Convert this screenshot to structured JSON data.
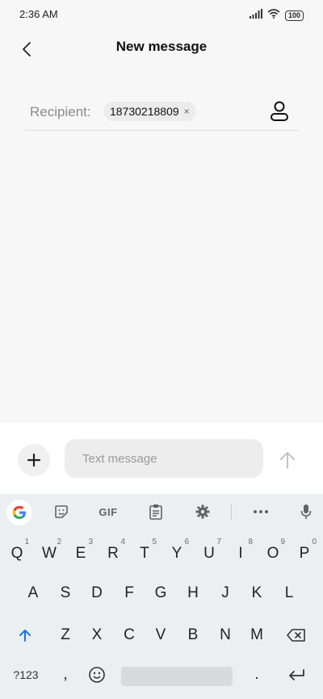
{
  "status": {
    "time": "2:36 AM",
    "battery": "100"
  },
  "header": {
    "title": "New message"
  },
  "recipient": {
    "label": "Recipient:",
    "chip": "18730218809",
    "remove": "×"
  },
  "compose": {
    "placeholder": "Text message"
  },
  "keyboard": {
    "toolbar": {
      "gif": "GIF"
    },
    "row1": [
      {
        "k": "Q",
        "h": "1"
      },
      {
        "k": "W",
        "h": "2"
      },
      {
        "k": "E",
        "h": "3"
      },
      {
        "k": "R",
        "h": "4"
      },
      {
        "k": "T",
        "h": "5"
      },
      {
        "k": "Y",
        "h": "6"
      },
      {
        "k": "U",
        "h": "7"
      },
      {
        "k": "I",
        "h": "8"
      },
      {
        "k": "O",
        "h": "9"
      },
      {
        "k": "P",
        "h": "0"
      }
    ],
    "row2": [
      "A",
      "S",
      "D",
      "F",
      "G",
      "H",
      "J",
      "K",
      "L"
    ],
    "row3": [
      "Z",
      "X",
      "C",
      "V",
      "B",
      "N",
      "M"
    ],
    "symbols_label": "?123",
    "comma": ",",
    "period": "."
  },
  "colors": {
    "accent": "#1a73e8",
    "background": "#f7f7f7",
    "keyboard": "#eceff1"
  }
}
